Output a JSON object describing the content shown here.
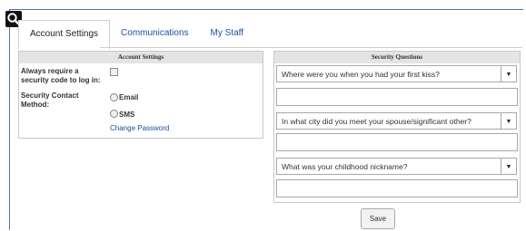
{
  "tabs": {
    "items": [
      {
        "label": "Account Settings",
        "active": true
      },
      {
        "label": "Communications",
        "active": false
      },
      {
        "label": "My Staff",
        "active": false
      }
    ]
  },
  "account_settings": {
    "heading": "Account Settings",
    "require_code_label": "Always require a security code to log in:",
    "require_code_checked": false,
    "contact_method_label": "Security Contact Method:",
    "options": [
      "Email",
      "SMS"
    ],
    "change_password": "Change Password"
  },
  "security_questions": {
    "heading": "Security Questions",
    "questions": [
      {
        "selected": "Where were you when you had your first kiss?",
        "answer": ""
      },
      {
        "selected": "In what city did you meet your spouse/significant other?",
        "answer": ""
      },
      {
        "selected": "What was your childhood nickname?",
        "answer": ""
      }
    ]
  },
  "save_label": "Save",
  "icons": {
    "zoom": "magnifier-icon",
    "dropdown": "caret-down-icon"
  }
}
